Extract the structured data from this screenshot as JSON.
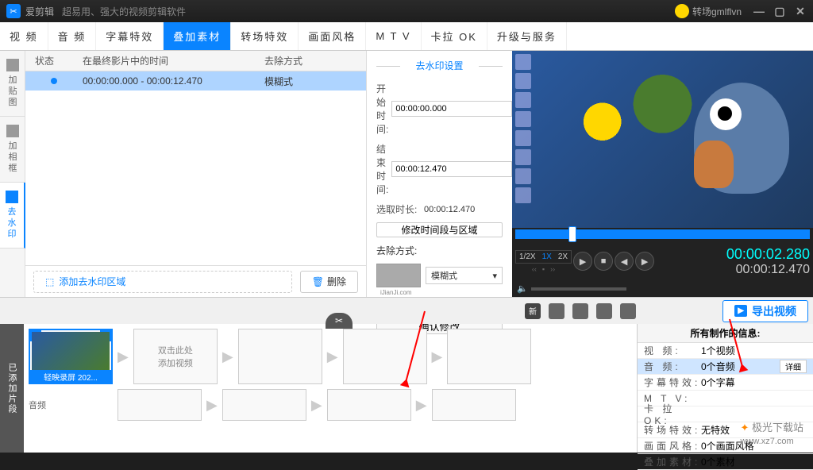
{
  "titlebar": {
    "app": "爱剪辑",
    "slogan": "超易用、强大的视频剪辑软件",
    "user": "转场gmlflvn"
  },
  "tabs": [
    "视  频",
    "音  频",
    "字幕特效",
    "叠加素材",
    "转场特效",
    "画面风格",
    "M T V",
    "卡拉 OK",
    "升级与服务"
  ],
  "active_tab": 3,
  "sidebar": [
    {
      "label": "加贴图"
    },
    {
      "label": "加相框"
    },
    {
      "label": "去水印"
    }
  ],
  "active_side": 2,
  "list": {
    "headers": {
      "status": "状态",
      "time": "在最终影片中的时间",
      "method": "去除方式"
    },
    "rows": [
      {
        "time": "00:00:00.000 - 00:00:12.470",
        "method": "模糊式",
        "selected": true
      }
    ],
    "add_btn": "添加去水印区域",
    "del_btn": "删除"
  },
  "settings": {
    "title": "去水印设置",
    "start_label": "开始时间:",
    "start_val": "00:00:00.000",
    "end_label": "结束时间:",
    "end_val": "00:00:12.470",
    "dur_label": "选取时长:",
    "dur_val": "00:00:12.470",
    "modify_range": "修改时间段与区域",
    "method_label": "去除方式:",
    "method_val": "模糊式",
    "confirm": "确认修改"
  },
  "preview": {
    "speeds": [
      "1/2X",
      "1X",
      "2X"
    ],
    "current": "00:00:02.280",
    "total": "00:00:12.470"
  },
  "toolbar": {
    "icons": [
      "新",
      "folder",
      "save",
      "help",
      "share"
    ],
    "export": "导出视频"
  },
  "clips": {
    "label": "已添加片段",
    "first_caption": "轻映录屏 202...",
    "placeholder": "双击此处\n添加视频",
    "audio_label": "音频"
  },
  "info": {
    "title": "所有制作的信息:",
    "rows": [
      {
        "k": "视    频:",
        "v": "1个视频"
      },
      {
        "k": "音    频:",
        "v": "0个音频",
        "hl": true,
        "detail": "详细"
      },
      {
        "k": "字幕特效:",
        "v": "0个字幕"
      },
      {
        "k": "M  T  V:",
        "v": ""
      },
      {
        "k": "卡 拉 OK:",
        "v": ""
      },
      {
        "k": "转场特效:",
        "v": "无特效"
      },
      {
        "k": "画面风格:",
        "v": "0个画面风格"
      },
      {
        "k": "叠加素材:",
        "v": "0个素材"
      }
    ]
  },
  "watermark": {
    "text": "极光下载站",
    "url": "www.xz7.com"
  }
}
